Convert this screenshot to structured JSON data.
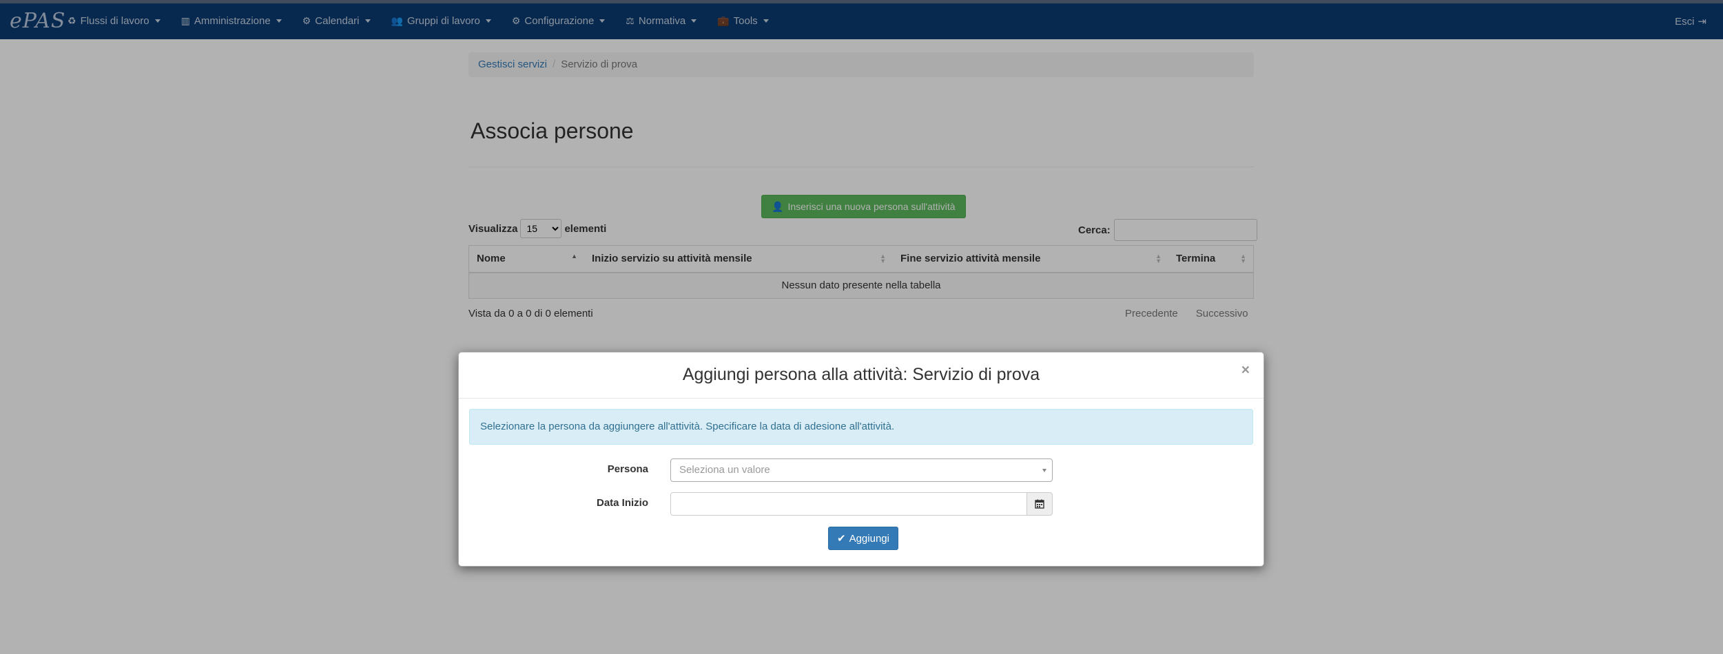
{
  "navbar": {
    "brand": "ePAS",
    "items": [
      {
        "label": "Flussi di lavoro",
        "icon": "recycle-icon"
      },
      {
        "label": "Amministrazione",
        "icon": "bar-chart-icon"
      },
      {
        "label": "Calendari",
        "icon": "gear-icon"
      },
      {
        "label": "Gruppi di lavoro",
        "icon": "users-icon"
      },
      {
        "label": "Configurazione",
        "icon": "cog-icon"
      },
      {
        "label": "Normativa",
        "icon": "balance-scale-icon"
      },
      {
        "label": "Tools",
        "icon": "suitcase-icon"
      }
    ],
    "logout": "Esci"
  },
  "breadcrumb": {
    "link": "Gestisci servizi",
    "current": "Servizio di prova"
  },
  "page": {
    "title": "Associa persone",
    "add_button": "Inserisci una nuova persona sull'attività"
  },
  "table": {
    "length_prefix": "Visualizza",
    "length_value": "15",
    "length_suffix": "elementi",
    "search_label": "Cerca:",
    "columns": [
      "Nome",
      "Inizio servizio su attività mensile",
      "Fine servizio attività mensile",
      "Termina"
    ],
    "empty": "Nessun dato presente nella tabella",
    "info": "Vista da 0 a 0 di 0 elementi",
    "prev": "Precedente",
    "next": "Successivo"
  },
  "modal": {
    "title": "Aggiungi persona alla attività: Servizio di prova",
    "close": "×",
    "alert": "Selezionare la persona da aggiungere all'attività. Specificare la data di adesione all'attività.",
    "persona_label": "Persona",
    "persona_placeholder": "Seleziona un valore",
    "data_label": "Data Inizio",
    "submit": "Aggiungi"
  },
  "colors": {
    "navbar": "#0b3b72",
    "success": "#5cb85c",
    "primary": "#337ab7",
    "info_bg": "#d9edf7"
  }
}
